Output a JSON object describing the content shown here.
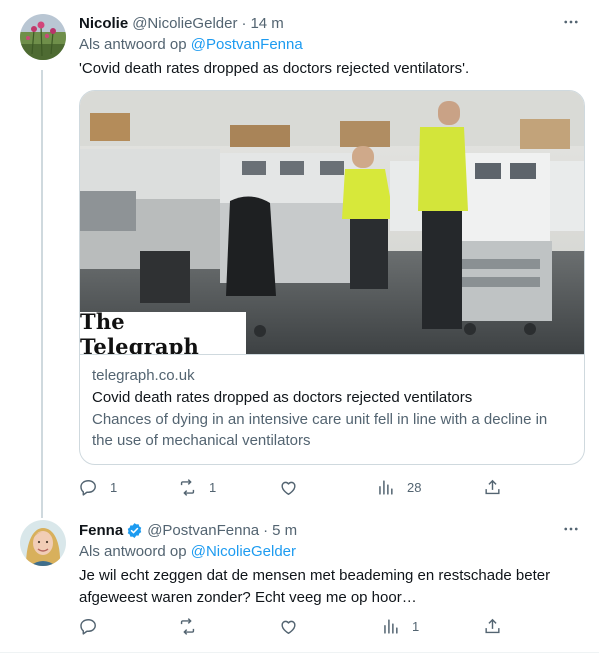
{
  "tweets": [
    {
      "display_name": "Nicolie",
      "handle": "@NicolieGelder",
      "time": "14 m",
      "reply_prefix": "Als antwoord op",
      "reply_mention": "@PostvanFenna",
      "text": "'Covid death rates dropped as doctors rejected ventilators'.",
      "card": {
        "logo_text": "The Telegraph",
        "domain": "telegraph.co.uk",
        "title": "Covid death rates dropped as doctors rejected ventilators",
        "description": "Chances of dying in an intensive care unit fell in line with a decline in the use of mechanical ventilators"
      },
      "stats": {
        "replies": "1",
        "retweets": "1",
        "likes": "",
        "views": "28"
      }
    },
    {
      "display_name": "Fenna",
      "handle": "@PostvanFenna",
      "time": "5 m",
      "reply_prefix": "Als antwoord op",
      "reply_mention": "@NicolieGelder",
      "text": "Je wil echt zeggen dat de mensen met beademing en restschade beter afgeweest waren zonder? Echt veeg me op hoor…",
      "stats": {
        "replies": "",
        "retweets": "",
        "likes": "",
        "views": "1"
      }
    }
  ],
  "icons": {
    "more": "more-icon",
    "reply": "reply-icon",
    "retweet": "retweet-icon",
    "like": "like-icon",
    "views": "views-icon",
    "share": "share-icon",
    "verified": "verified-badge-icon"
  },
  "colors": {
    "link": "#1d9bf0",
    "secondary_text": "#536471",
    "primary_text": "#0f1419",
    "border": "#cfd9de",
    "verified": "#1d9bf0"
  }
}
